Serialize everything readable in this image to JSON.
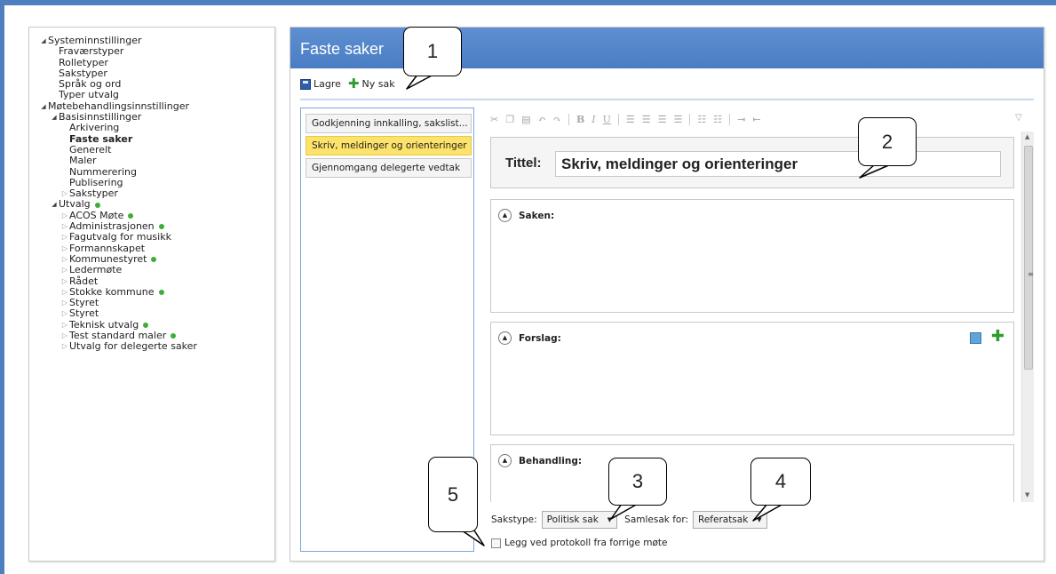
{
  "tree": {
    "items": [
      {
        "label": "Systeminnstillinger",
        "level": 0,
        "arrow": "expanded",
        "dot": false,
        "bold": false
      },
      {
        "label": "Fraværstyper",
        "level": 1,
        "arrow": "none",
        "dot": false,
        "bold": false
      },
      {
        "label": "Rolletyper",
        "level": 1,
        "arrow": "none",
        "dot": false,
        "bold": false
      },
      {
        "label": "Sakstyper",
        "level": 1,
        "arrow": "none",
        "dot": false,
        "bold": false
      },
      {
        "label": "Språk og ord",
        "level": 1,
        "arrow": "none",
        "dot": false,
        "bold": false
      },
      {
        "label": "Typer utvalg",
        "level": 1,
        "arrow": "none",
        "dot": false,
        "bold": false
      },
      {
        "label": "Møtebehandlingsinnstillinger",
        "level": 0,
        "arrow": "expanded",
        "dot": false,
        "bold": false
      },
      {
        "label": "Basisinnstillinger",
        "level": 1,
        "arrow": "expanded",
        "dot": false,
        "bold": false
      },
      {
        "label": "Arkivering",
        "level": 2,
        "arrow": "none",
        "dot": false,
        "bold": false
      },
      {
        "label": "Faste saker",
        "level": 2,
        "arrow": "none",
        "dot": false,
        "bold": true
      },
      {
        "label": "Generelt",
        "level": 2,
        "arrow": "none",
        "dot": false,
        "bold": false
      },
      {
        "label": "Maler",
        "level": 2,
        "arrow": "none",
        "dot": false,
        "bold": false
      },
      {
        "label": "Nummerering",
        "level": 2,
        "arrow": "none",
        "dot": false,
        "bold": false
      },
      {
        "label": "Publisering",
        "level": 2,
        "arrow": "none",
        "dot": false,
        "bold": false
      },
      {
        "label": "Sakstyper",
        "level": 2,
        "arrow": "collapsed",
        "dot": false,
        "bold": false
      },
      {
        "label": "Utvalg",
        "level": 1,
        "arrow": "expanded",
        "dot": true,
        "bold": false
      },
      {
        "label": "ACOS Møte",
        "level": 2,
        "arrow": "collapsed",
        "dot": true,
        "bold": false
      },
      {
        "label": "Administrasjonen",
        "level": 2,
        "arrow": "collapsed",
        "dot": true,
        "bold": false
      },
      {
        "label": "Fagutvalg for musikk",
        "level": 2,
        "arrow": "collapsed",
        "dot": false,
        "bold": false
      },
      {
        "label": "Formannskapet",
        "level": 2,
        "arrow": "collapsed",
        "dot": false,
        "bold": false
      },
      {
        "label": "Kommunestyret",
        "level": 2,
        "arrow": "collapsed",
        "dot": true,
        "bold": false
      },
      {
        "label": "Ledermøte",
        "level": 2,
        "arrow": "collapsed",
        "dot": false,
        "bold": false
      },
      {
        "label": "Rådet",
        "level": 2,
        "arrow": "collapsed",
        "dot": false,
        "bold": false
      },
      {
        "label": "Stokke kommune",
        "level": 2,
        "arrow": "collapsed",
        "dot": true,
        "bold": false
      },
      {
        "label": "Styret",
        "level": 2,
        "arrow": "collapsed",
        "dot": false,
        "bold": false
      },
      {
        "label": "Styret",
        "level": 2,
        "arrow": "collapsed",
        "dot": false,
        "bold": false
      },
      {
        "label": "Teknisk utvalg",
        "level": 2,
        "arrow": "collapsed",
        "dot": true,
        "bold": false
      },
      {
        "label": "Test standard maler",
        "level": 2,
        "arrow": "collapsed",
        "dot": true,
        "bold": false
      },
      {
        "label": "Utvalg for delegerte saker",
        "level": 2,
        "arrow": "collapsed",
        "dot": false,
        "bold": false
      }
    ]
  },
  "panel": {
    "title": "Faste saker",
    "save_label": "Lagre",
    "new_label": "Ny sak"
  },
  "list": {
    "items": [
      {
        "label": "Godkjenning innkalling, sakslist...",
        "selected": false
      },
      {
        "label": "Skriv, meldinger og orienteringer",
        "selected": true
      },
      {
        "label": "Gjennomgang delegerte vedtak",
        "selected": false
      }
    ]
  },
  "editor": {
    "toolbar_icons": [
      "cut-icon",
      "copy-icon",
      "paste-icon",
      "undo-icon",
      "redo-icon",
      "bold-icon",
      "italic-icon",
      "underline-icon",
      "align-left-icon",
      "align-center-icon",
      "align-right-icon",
      "justify-icon",
      "bullet-list-icon",
      "numbered-list-icon",
      "indent-icon",
      "outdent-icon"
    ],
    "title_label": "Tittel:",
    "title_value": "Skriv, meldinger og orienteringer",
    "sections": {
      "saken": "Saken:",
      "forslag": "Forslag:",
      "behandling": "Behandling:"
    }
  },
  "bottom": {
    "sakstype_label": "Sakstype:",
    "sakstype_value": "Politisk sak",
    "samlesak_label": "Samlesak for:",
    "samlesak_value": "Referatsak",
    "checkbox_label": "Legg ved protokoll fra forrige møte"
  },
  "callouts": {
    "c1": "1",
    "c2": "2",
    "c3": "3",
    "c4": "4",
    "c5": "5"
  },
  "colors": {
    "accent": "#4f7fbf",
    "selected": "#fde36a",
    "status_dot": "#3fae38",
    "add_green": "#2e9c2e"
  }
}
